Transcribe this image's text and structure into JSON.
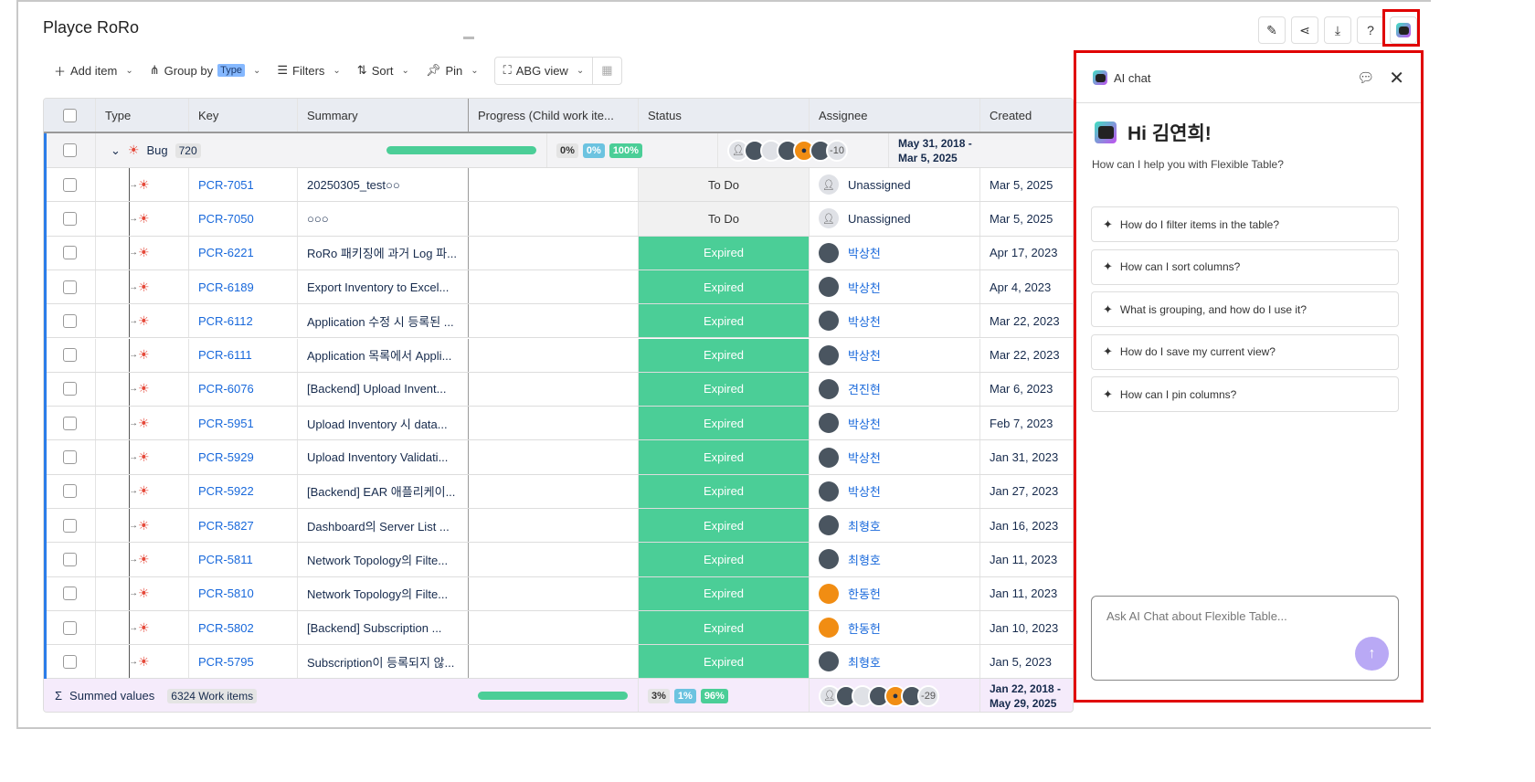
{
  "title": "Playce RoRo",
  "toolbar": {
    "add_item": "Add item",
    "group_by": "Group by",
    "group_tag": "Type",
    "filters": "Filters",
    "sort": "Sort",
    "pin": "Pin",
    "view": "ABG view"
  },
  "columns": [
    "Type",
    "Key",
    "Summary",
    "Progress (Child work ite...",
    "Status",
    "Assignee",
    "Created"
  ],
  "group": {
    "type": "Bug",
    "count": "720",
    "pct_todo": "0%",
    "pct_inprog": "0%",
    "pct_done": "100%",
    "assignee_more": "-10",
    "created": "May 31, 2018 - Mar 5, 2025"
  },
  "rows": [
    {
      "key": "PCR-7051",
      "summary": "20250305_test○○",
      "status": "To Do",
      "assignee": "Unassigned",
      "created": "Mar 5, 2025"
    },
    {
      "key": "PCR-7050",
      "summary": "○○○",
      "status": "To Do",
      "assignee": "Unassigned",
      "created": "Mar 5, 2025"
    },
    {
      "key": "PCR-6221",
      "summary": "RoRo 패키징에 과거 Log 파...",
      "status": "Expired",
      "assignee": "박상천",
      "created": "Apr 17, 2023"
    },
    {
      "key": "PCR-6189",
      "summary": "Export Inventory to Excel...",
      "status": "Expired",
      "assignee": "박상천",
      "created": "Apr 4, 2023"
    },
    {
      "key": "PCR-6112",
      "summary": "Application 수정 시 등록된 ...",
      "status": "Expired",
      "assignee": "박상천",
      "created": "Mar 22, 2023"
    },
    {
      "key": "PCR-6111",
      "summary": "Application 목록에서 Appli...",
      "status": "Expired",
      "assignee": "박상천",
      "created": "Mar 22, 2023"
    },
    {
      "key": "PCR-6076",
      "summary": "[Backend] Upload Invent...",
      "status": "Expired",
      "assignee": "견진현",
      "created": "Mar 6, 2023"
    },
    {
      "key": "PCR-5951",
      "summary": "Upload Inventory 시 data...",
      "status": "Expired",
      "assignee": "박상천",
      "created": "Feb 7, 2023"
    },
    {
      "key": "PCR-5929",
      "summary": "Upload Inventory Validati...",
      "status": "Expired",
      "assignee": "박상천",
      "created": "Jan 31, 2023"
    },
    {
      "key": "PCR-5922",
      "summary": "[Backend] EAR 애플리케이...",
      "status": "Expired",
      "assignee": "박상천",
      "created": "Jan 27, 2023"
    },
    {
      "key": "PCR-5827",
      "summary": "Dashboard의 Server List ...",
      "status": "Expired",
      "assignee": "최형호",
      "created": "Jan 16, 2023"
    },
    {
      "key": "PCR-5811",
      "summary": "Network Topology의 Filte...",
      "status": "Expired",
      "assignee": "최형호",
      "created": "Jan 11, 2023"
    },
    {
      "key": "PCR-5810",
      "summary": "Network Topology의 Filte...",
      "status": "Expired",
      "assignee": "한동헌",
      "created": "Jan 11, 2023"
    },
    {
      "key": "PCR-5802",
      "summary": "[Backend] Subscription ...",
      "status": "Expired",
      "assignee": "한동헌",
      "created": "Jan 10, 2023"
    },
    {
      "key": "PCR-5795",
      "summary": "Subscription이 등록되지 않...",
      "status": "Expired",
      "assignee": "최형호",
      "created": "Jan 5, 2023"
    }
  ],
  "summary": {
    "label": "Summed values",
    "count": "6324 Work items",
    "pct_todo": "3%",
    "pct_inprog": "1%",
    "pct_done": "96%",
    "assignee_more": "-29",
    "created": "Jan 22, 2018 - May 29, 2025"
  },
  "chat": {
    "title": "AI chat",
    "greeting": "Hi 김연희!",
    "subtitle": "How can I help you with Flexible Table?",
    "suggestions": [
      "How do I filter items in the table?",
      "How can I sort columns?",
      "What is grouping, and how do I use it?",
      "How do I save my current view?",
      "How can I pin columns?"
    ],
    "placeholder": "Ask AI Chat about Flexible Table..."
  }
}
